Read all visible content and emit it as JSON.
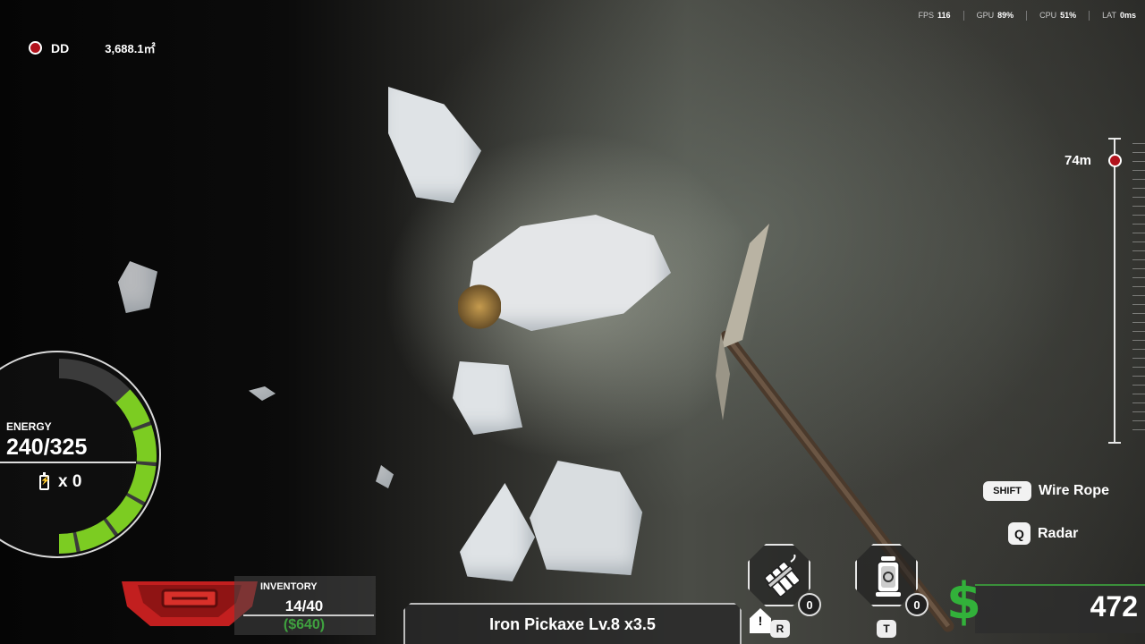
{
  "location": {
    "code": "DD",
    "area": "3,688.1㎡"
  },
  "perf": [
    {
      "label": "FPS",
      "value": "116"
    },
    {
      "label": "GPU",
      "value": "89%"
    },
    {
      "label": "CPU",
      "value": "51%"
    },
    {
      "label": "LAT",
      "value": "0ms"
    }
  ],
  "depth": {
    "label": "74m"
  },
  "hints": {
    "wire_rope": {
      "key": "SHIFT",
      "label": "Wire Rope"
    },
    "radar": {
      "key": "Q",
      "label": "Radar"
    }
  },
  "energy": {
    "title": "ENERGY",
    "value": "240/325",
    "batteries": "x 0",
    "level": 0.74
  },
  "inventory": {
    "title": "INVENTORY",
    "count": "14/40",
    "value": "($640)"
  },
  "tool": {
    "name": "Iron Pickaxe Lv.8 x3.5"
  },
  "slots": [
    {
      "icon": "dynamite-icon",
      "count": "0",
      "key": "R",
      "alert": "!"
    },
    {
      "icon": "lantern-icon",
      "count": "0",
      "key": "T"
    }
  ],
  "money": {
    "symbol": "$",
    "value": "472"
  },
  "colors": {
    "accent_red": "#b1121c",
    "energy_green": "#7ccc22",
    "money_green": "#32b13a"
  }
}
